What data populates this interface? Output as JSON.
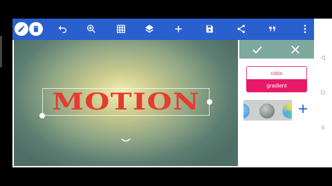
{
  "toolbar": {
    "buttons": [
      "pencil-icon",
      "trash-icon",
      "undo-icon",
      "zoom-in-icon",
      "grid-icon",
      "layers-icon",
      "add-icon",
      "save-icon",
      "share-icon",
      "quote-icon",
      "more-icon"
    ],
    "background_color": "#2a5fce"
  },
  "canvas": {
    "text_layer": "MOTION",
    "text_color": "#e63c30"
  },
  "panel": {
    "confirm_icon": "check-icon",
    "close_icon": "close-icon",
    "mode_options": {
      "color": "color",
      "gradient": "gradient"
    },
    "selected_mode": "gradient",
    "accent_color": "#e9196a",
    "header_color": "#7fa89e",
    "add_swatch_icon": "plus-icon"
  },
  "navigation": [
    "back-icon",
    "home-icon",
    "recents-icon"
  ]
}
